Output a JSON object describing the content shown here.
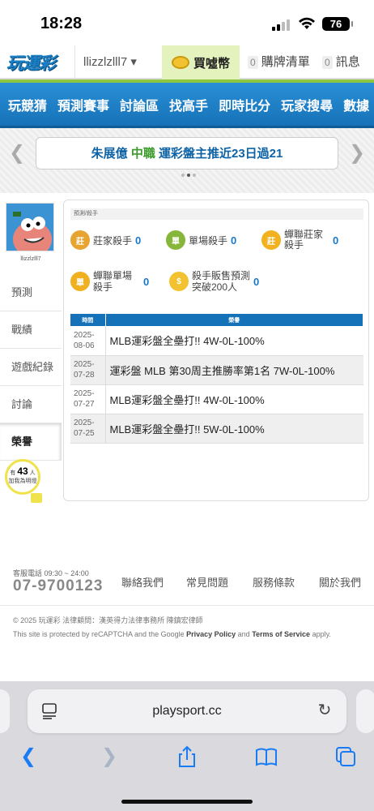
{
  "status_bar": {
    "time": "18:28",
    "battery": "76"
  },
  "header": {
    "logo": "玩運彩",
    "username": "llizzlzlll7 ▾",
    "buy_label": "買噓幣",
    "cart_count": "0",
    "cart_label": "購牌清單",
    "msg_count": "0",
    "msg_label": "訊息"
  },
  "menu": [
    "玩競猜",
    "預測賽事",
    "討論區",
    "找高手",
    "即時比分",
    "玩家搜尋",
    "數據"
  ],
  "announcement": {
    "name": "朱展億",
    "league": "中職",
    "text": "運彩盤主推近23日過21"
  },
  "profile": {
    "username": "llizzlzlll7"
  },
  "side_menu": [
    "預測",
    "戰績",
    "遊戲紀錄",
    "討論",
    "榮譽"
  ],
  "followers": {
    "prefix": "有",
    "count": "43",
    "suffix": "人",
    "line2": "加我為明燈"
  },
  "panel": {
    "breadcrumb": "預測/殺手",
    "badges": [
      {
        "label": "莊家殺手",
        "count": "0",
        "icon": "banker-killer-medal",
        "color": "#e8a431"
      },
      {
        "label": "單場殺手",
        "count": "0",
        "icon": "single-killer-medal",
        "color": "#86b73a"
      },
      {
        "label": "蟬聯莊家殺手",
        "count": "0",
        "icon": "consecutive-banker-medal",
        "color": "#f2b21f"
      },
      {
        "label": "蟬聯單場殺手",
        "count": "0",
        "icon": "consecutive-single-medal",
        "color": "#f0b020"
      },
      {
        "label": "殺手販售預測突破200人",
        "count": "0",
        "icon": "gold-coin-medal",
        "color": "#f2c230"
      }
    ],
    "table": {
      "headers": [
        "時間",
        "榮譽"
      ],
      "rows": [
        {
          "date1": "2025-",
          "date2": "08-06",
          "title": "MLB運彩盤全壘打!! 4W-0L-100%"
        },
        {
          "date1": "2025-",
          "date2": "07-28",
          "title": "運彩盤 MLB 第30周主推勝率第1名 7W-0L-100%"
        },
        {
          "date1": "2025-",
          "date2": "07-27",
          "title": "MLB運彩盤全壘打!! 4W-0L-100%"
        },
        {
          "date1": "2025-",
          "date2": "07-25",
          "title": "MLB運彩盤全壘打!! 5W-0L-100%"
        }
      ]
    }
  },
  "footer": {
    "service_label": "客服電話 09:30 ~ 24:00",
    "phone": "07-9700123",
    "links": [
      "聯絡我們",
      "常見問題",
      "服務條款",
      "關於我們"
    ],
    "copyright": "© 2025 玩運彩 法律顧問：漢英得力法律事務所 陳鎮宏律師",
    "recaptcha_pre": "This site is protected by reCAPTCHA and the Google ",
    "privacy": "Privacy Policy",
    "and": " and ",
    "terms": "Terms of Service",
    "apply": " apply."
  },
  "browser": {
    "url": "playsport.cc"
  }
}
